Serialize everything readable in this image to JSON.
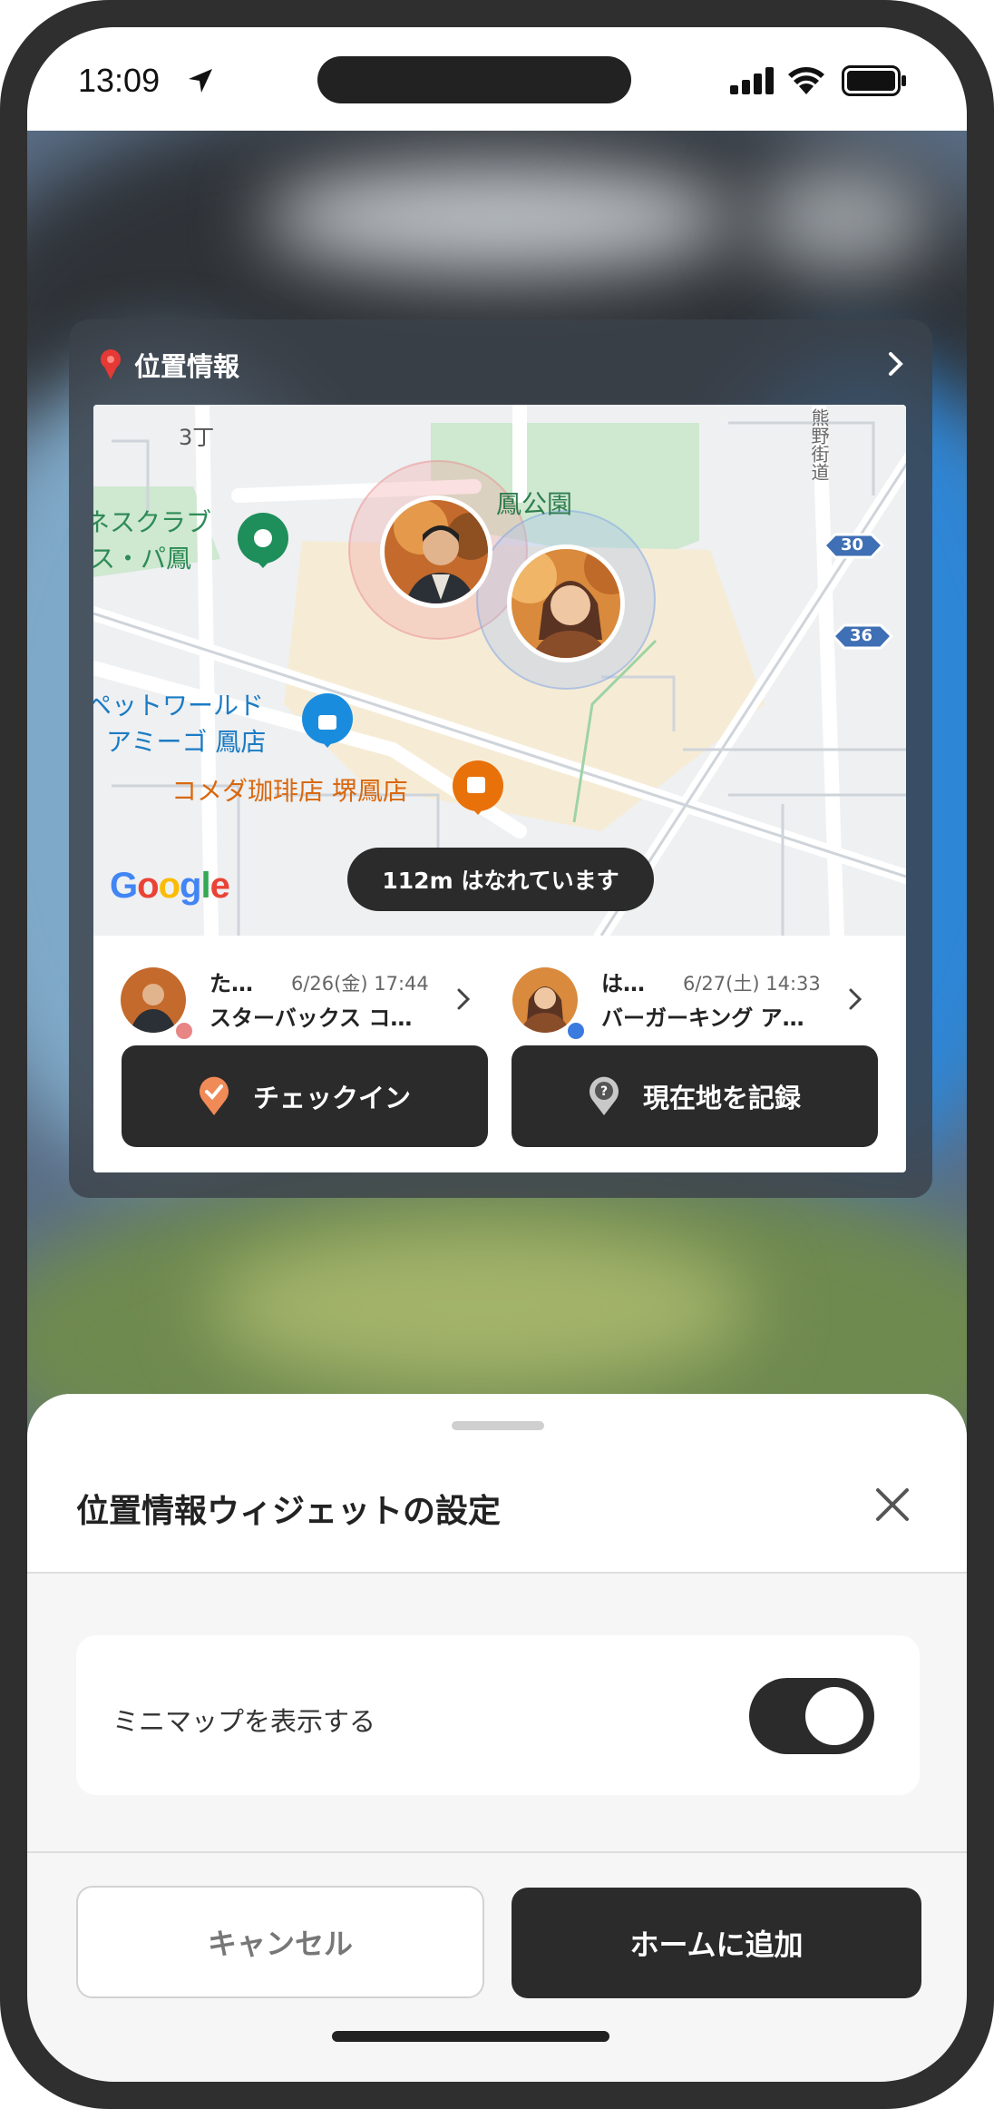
{
  "status_bar": {
    "time": "13:09"
  },
  "widget": {
    "title": "位置情報",
    "map": {
      "labels": {
        "block": "3丁",
        "park": "鳳公園",
        "club_line1": "ネスクラブ",
        "club_line2": "ス・パ鳳",
        "petworld_line1": "ペットワールド",
        "petworld_line2": "アミーゴ 鳳店",
        "komeda": "コメダ珈琲店 堺鳳店",
        "road_vertical": "熊野街道",
        "route_30": "30",
        "route_36": "36",
        "google": "Google"
      },
      "distance_text": "112m はなれています"
    },
    "people": [
      {
        "name": "た…",
        "time": "6/26(金) 17:44",
        "place": "スターバックス コ…",
        "dot_color": "#e88585"
      },
      {
        "name": "は…",
        "time": "6/27(土) 14:33",
        "place": "バーガーキング ア…",
        "dot_color": "#3b7be0"
      }
    ],
    "buttons": {
      "checkin": "チェックイン",
      "record_location": "現在地を記録"
    }
  },
  "sheet": {
    "title": "位置情報ウィジェットの設定",
    "setting_label": "ミニマップを表示する",
    "toggle_on": true,
    "cancel": "キャンセル",
    "add_home": "ホームに追加"
  }
}
